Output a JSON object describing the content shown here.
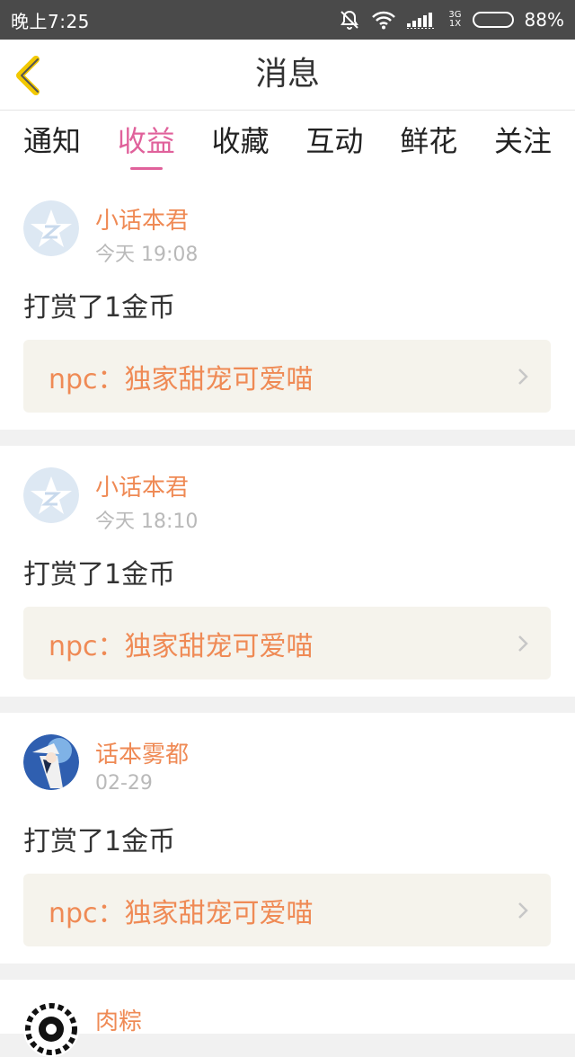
{
  "status": {
    "time": "晚上7:25",
    "network_top": "3G",
    "network_bottom": "1X",
    "battery": "88%",
    "battery_level": 0.88
  },
  "header": {
    "title": "消息"
  },
  "tabs": [
    {
      "label": "通知",
      "active": false
    },
    {
      "label": "收益",
      "active": true
    },
    {
      "label": "收藏",
      "active": false
    },
    {
      "label": "互动",
      "active": false
    },
    {
      "label": "鲜花",
      "active": false
    },
    {
      "label": "关注",
      "active": false
    }
  ],
  "messages": [
    {
      "user": "小话本君",
      "time": "今天 19:08",
      "text": "打赏了1金币",
      "book": "npc：独家甜宠可爱喵"
    },
    {
      "user": "小话本君",
      "time": "今天 18:10",
      "text": "打赏了1金币",
      "book": "npc：独家甜宠可爱喵"
    },
    {
      "user": "话本雾都",
      "time": "02-29",
      "text": "打赏了1金币",
      "book": "npc：独家甜宠可爱喵"
    },
    {
      "user": "肉粽"
    }
  ],
  "colors": {
    "accent_pink": "#e0619b",
    "accent_orange": "#ef8a55",
    "statusbar": "#4a4a4a"
  }
}
